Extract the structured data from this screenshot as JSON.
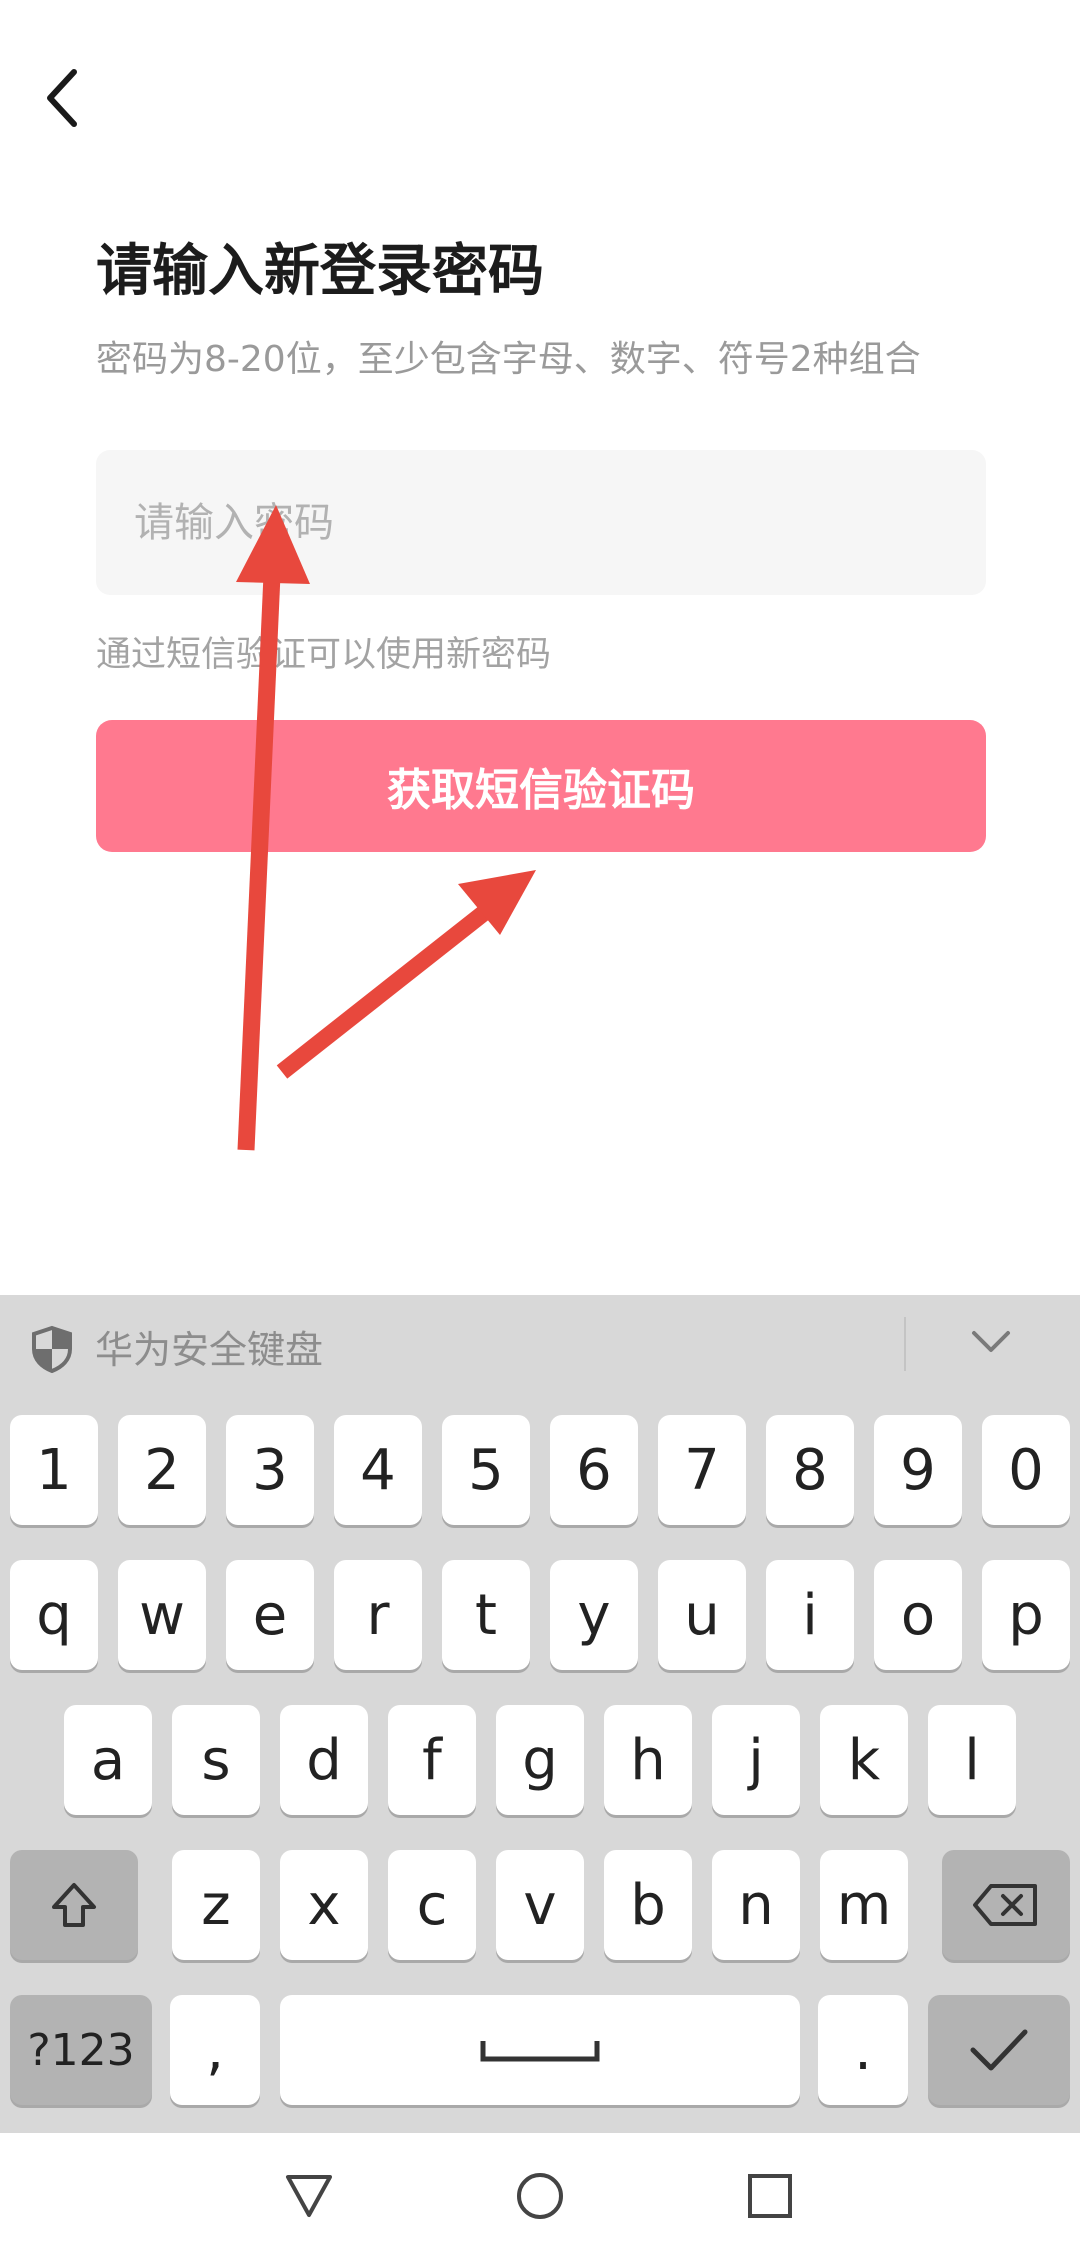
{
  "header": {
    "back_icon": "chevron-left-icon"
  },
  "page": {
    "title": "请输入新登录密码",
    "subtitle": "密码为8-20位，至少包含字母、数字、符号2种组合",
    "password_placeholder": "请输入密码",
    "password_value": "",
    "hint": "通过短信验证可以使用新密码",
    "sms_button_label": "获取短信验证码"
  },
  "colors": {
    "primary_button": "#ff798f",
    "annotation_arrow": "#e8483d",
    "keyboard_bg": "#d8d8d8"
  },
  "annotation": {
    "arrows": 2,
    "icon": "red-arrow-icon"
  },
  "keyboard": {
    "brand": "华为安全键盘",
    "brand_icon": "shield-icon",
    "collapse_icon": "chevron-down-icon",
    "row_numbers": [
      "1",
      "2",
      "3",
      "4",
      "5",
      "6",
      "7",
      "8",
      "9",
      "0"
    ],
    "row_top": [
      "q",
      "w",
      "e",
      "r",
      "t",
      "y",
      "u",
      "i",
      "o",
      "p"
    ],
    "row_home": [
      "a",
      "s",
      "d",
      "f",
      "g",
      "h",
      "j",
      "k",
      "l"
    ],
    "row_bottom": [
      "z",
      "x",
      "c",
      "v",
      "b",
      "n",
      "m"
    ],
    "shift_icon": "shift-icon",
    "backspace_icon": "backspace-icon",
    "mode_label": "?123",
    "comma_label": ",",
    "space_icon": "space-bar-icon",
    "period_label": ".",
    "enter_icon": "checkmark-icon"
  },
  "nav": {
    "back_icon": "triangle-back-icon",
    "home_icon": "circle-home-icon",
    "recents_icon": "square-recents-icon"
  }
}
